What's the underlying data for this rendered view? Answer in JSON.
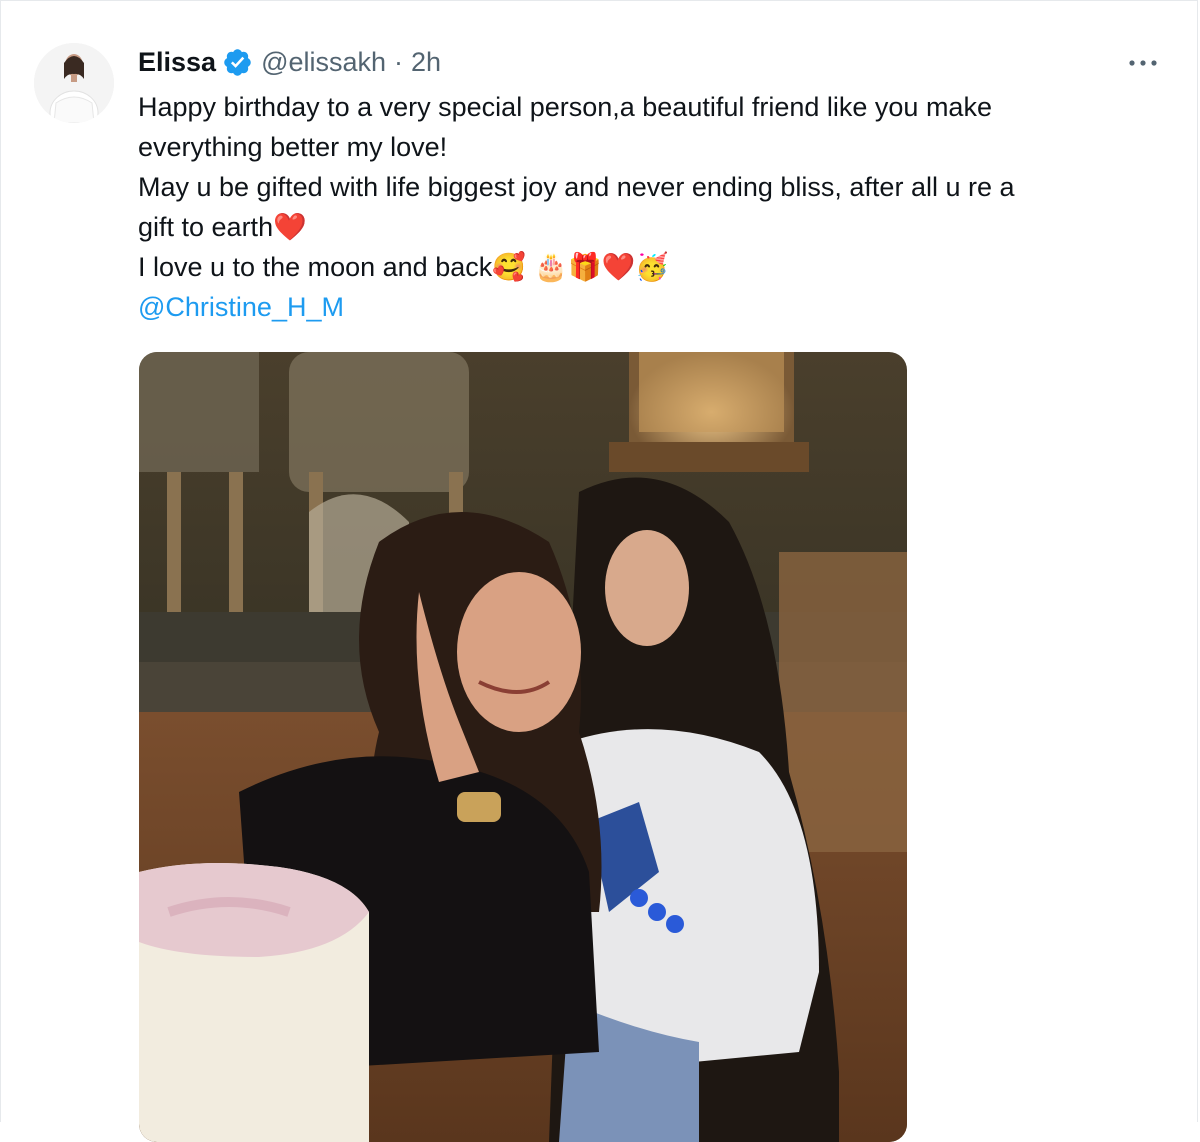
{
  "author": {
    "display_name": "Elissa",
    "handle": "@elissakh",
    "separator": "·",
    "time": "2h",
    "verified": true
  },
  "tweet": {
    "lines": [
      "Happy birthday to a very special person,a beautiful friend like you make",
      "everything better my love!",
      "May u be gifted with life biggest joy and never ending bliss, after all u re a",
      "gift to earth",
      "I love u to the moon and back"
    ],
    "emoji_after_line_4": "❤️",
    "emoji_after_line_5": "🥰 🎂🎁❤️🥳",
    "mention": "@Christine_H_M"
  },
  "icons": {
    "verified": "verified-badge-icon",
    "more": "more-options-icon"
  },
  "colors": {
    "text": "#0f1419",
    "secondary": "#536471",
    "link": "#1d9bf0",
    "verified": "#1d9bf0",
    "heart": "#e0245e"
  }
}
